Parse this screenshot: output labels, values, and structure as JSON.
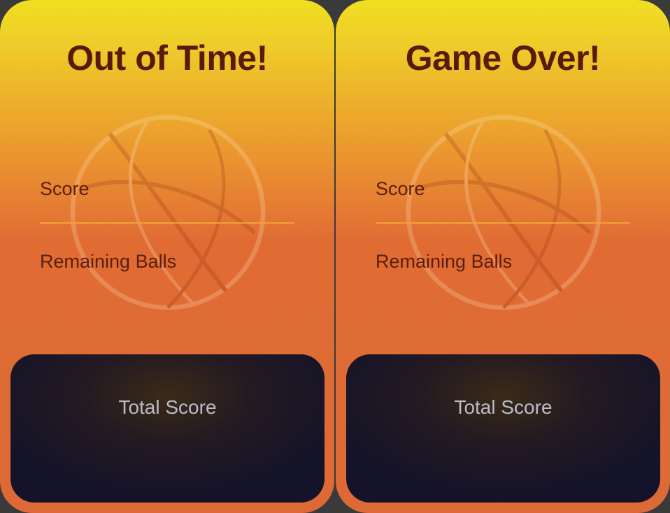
{
  "screens": [
    {
      "title": "Out of Time!",
      "score_label": "Score",
      "remaining_label": "Remaining Balls",
      "total_label": "Total Score"
    },
    {
      "title": "Game Over!",
      "score_label": "Score",
      "remaining_label": "Remaining Balls",
      "total_label": "Total Score"
    }
  ],
  "colors": {
    "gradient_top": "#f0df22",
    "gradient_bottom": "#dd6a36",
    "title_text": "#5a1a0a",
    "panel_bg": "#141329",
    "panel_text": "#b9bcc8"
  },
  "icons": [
    "basketball-icon"
  ]
}
